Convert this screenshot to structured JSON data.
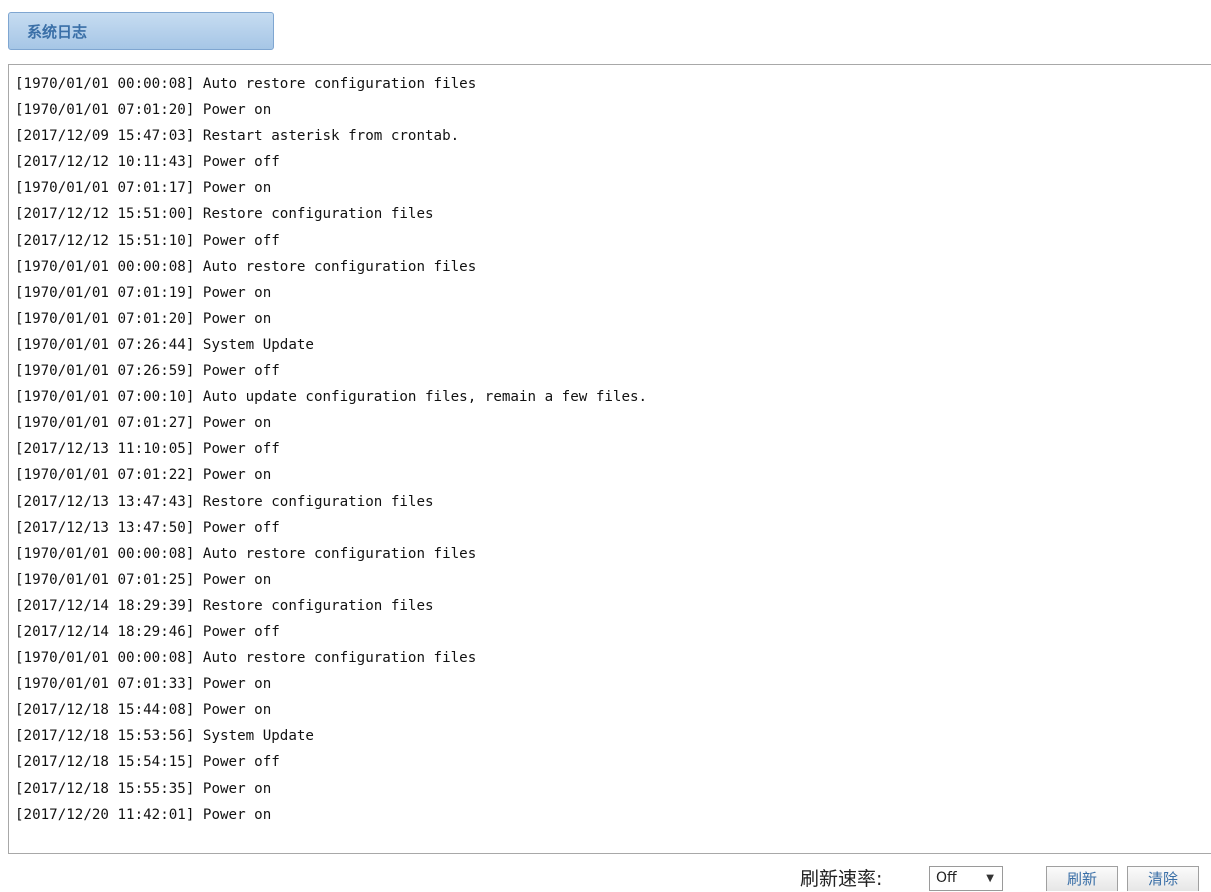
{
  "tab": {
    "title": "系统日志"
  },
  "log": {
    "lines": [
      "[1970/01/01 00:00:08] Auto restore configuration files",
      "[1970/01/01 07:01:20] Power on",
      "[2017/12/09 15:47:03] Restart asterisk from crontab.",
      "[2017/12/12 10:11:43] Power off",
      "[1970/01/01 07:01:17] Power on",
      "[2017/12/12 15:51:00] Restore configuration files",
      "[2017/12/12 15:51:10] Power off",
      "[1970/01/01 00:00:08] Auto restore configuration files",
      "[1970/01/01 07:01:19] Power on",
      "[1970/01/01 07:01:20] Power on",
      "[1970/01/01 07:26:44] System Update",
      "[1970/01/01 07:26:59] Power off",
      "[1970/01/01 07:00:10] Auto update configuration files, remain a few files.",
      "[1970/01/01 07:01:27] Power on",
      "[2017/12/13 11:10:05] Power off",
      "[1970/01/01 07:01:22] Power on",
      "[2017/12/13 13:47:43] Restore configuration files",
      "[2017/12/13 13:47:50] Power off",
      "[1970/01/01 00:00:08] Auto restore configuration files",
      "[1970/01/01 07:01:25] Power on",
      "[2017/12/14 18:29:39] Restore configuration files",
      "[2017/12/14 18:29:46] Power off",
      "[1970/01/01 00:00:08] Auto restore configuration files",
      "[1970/01/01 07:01:33] Power on",
      "[2017/12/18 15:44:08] Power on",
      "[2017/12/18 15:53:56] System Update",
      "[2017/12/18 15:54:15] Power off",
      "[2017/12/18 15:55:35] Power on",
      "[2017/12/20 11:42:01] Power on"
    ]
  },
  "controls": {
    "refresh_rate_label": "刷新速率:",
    "refresh_rate_value": "Off",
    "refresh_button": "刷新",
    "clear_button": "清除"
  }
}
